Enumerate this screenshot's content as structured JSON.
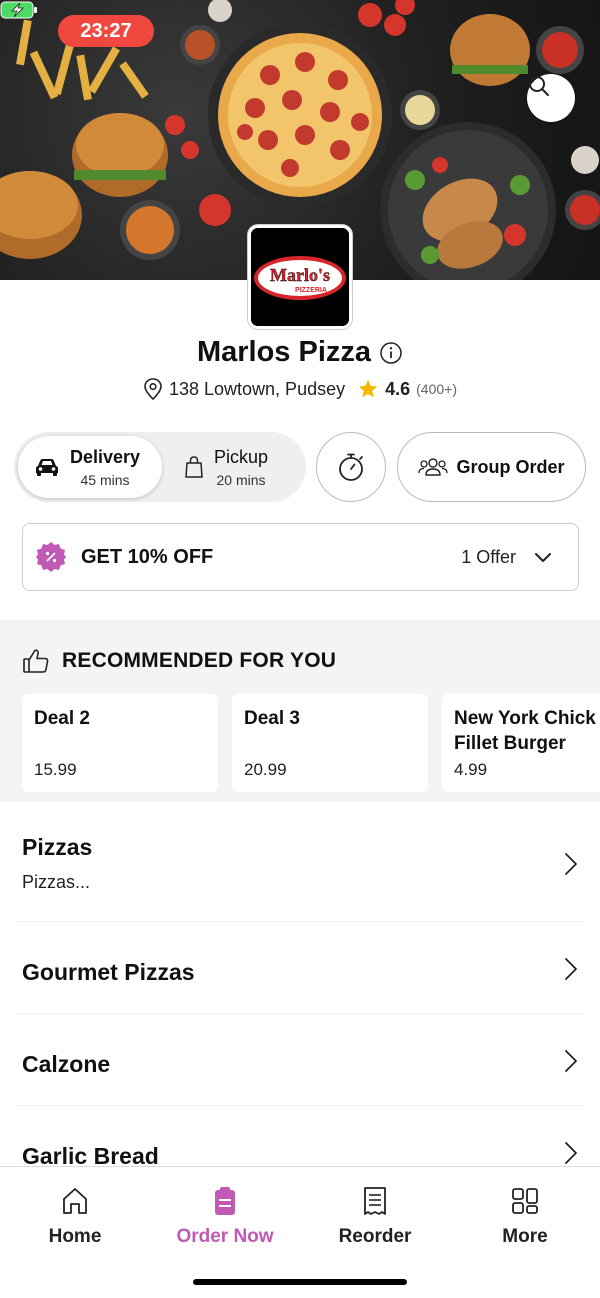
{
  "status": {
    "time": "23:27"
  },
  "store": {
    "name": "Marlos Pizza",
    "logo_text": "Marlo's",
    "logo_sub": "PIZZERIA",
    "address": "138 Lowtown, Pudsey",
    "rating": "4.6",
    "rating_count": "(400+)"
  },
  "order_mode": {
    "delivery_label": "Delivery",
    "delivery_time": "45 mins",
    "pickup_label": "Pickup",
    "pickup_time": "20 mins",
    "group_label": "Group Order"
  },
  "offer": {
    "title": "GET 10% OFF",
    "count": "1 Offer"
  },
  "recommended": {
    "title": "RECOMMENDED FOR YOU",
    "items": [
      {
        "name": "Deal 2",
        "price": "15.99"
      },
      {
        "name": "Deal 3",
        "price": "20.99"
      },
      {
        "name": "New York Chick",
        "name2": "Fillet Burger",
        "price": "4.99"
      }
    ]
  },
  "categories": [
    {
      "name": "Pizzas",
      "desc": "Pizzas..."
    },
    {
      "name": "Gourmet Pizzas"
    },
    {
      "name": "Calzone"
    },
    {
      "name": "Garlic Bread"
    }
  ],
  "nav": {
    "home": "Home",
    "order_now": "Order Now",
    "reorder": "Reorder",
    "more": "More"
  },
  "colors": {
    "accent": "#c05ab5",
    "status_red": "#f0473f",
    "star": "#f5b800"
  }
}
